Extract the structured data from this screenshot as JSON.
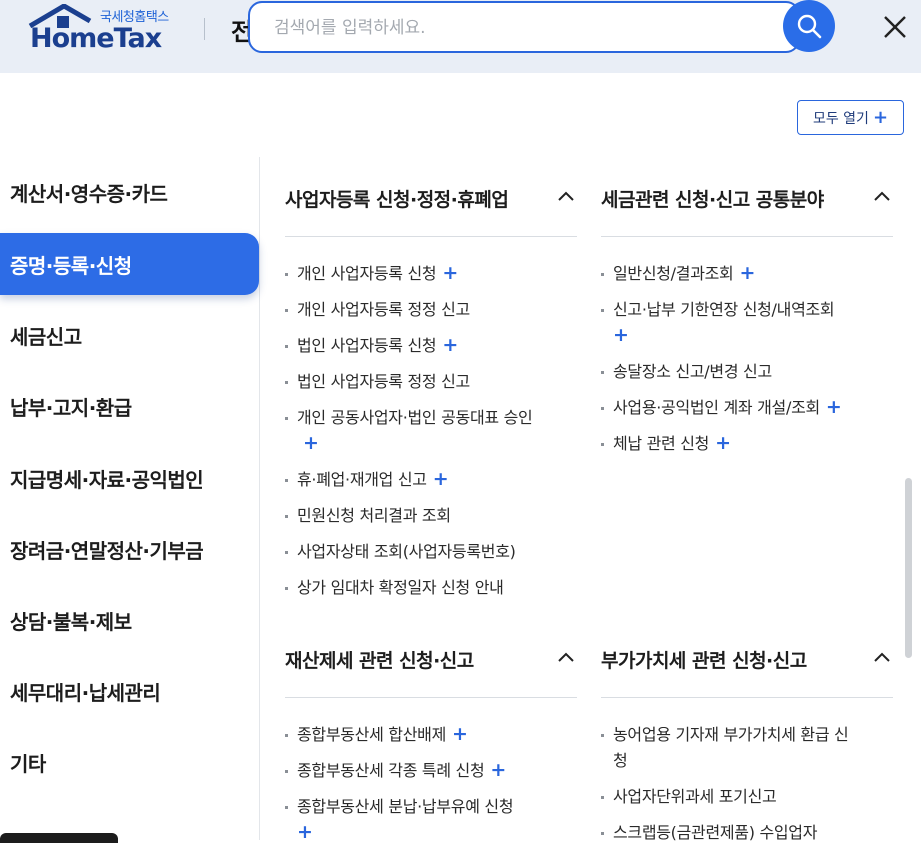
{
  "header": {
    "logo_small": "국세청홈택스",
    "logo_big": "HomeTax",
    "title_partial": "전",
    "search_placeholder": "검색어를 입력하세요.",
    "search_icon": "search-icon",
    "close_icon": "close-icon"
  },
  "open_all_label": "모두 열기",
  "sidebar": {
    "items": [
      {
        "label": "계산서·영수증·카드"
      },
      {
        "label": "증명·등록·신청",
        "active": true
      },
      {
        "label": "세금신고"
      },
      {
        "label": "납부·고지·환급"
      },
      {
        "label": "지급명세·자료·공익법인"
      },
      {
        "label": "장려금·연말정산·기부금"
      },
      {
        "label": "상담·불복·제보"
      },
      {
        "label": "세무대리·납세관리"
      },
      {
        "label": "기타"
      }
    ]
  },
  "sections": [
    {
      "title": "사업자등록 신청·정정·휴폐업",
      "items": [
        {
          "label": "개인 사업자등록 신청",
          "plus": true
        },
        {
          "label": "개인 사업자등록 정정 신고"
        },
        {
          "label": "법인 사업자등록 신청",
          "plus": true
        },
        {
          "label": "법인 사업자등록 정정 신고"
        },
        {
          "label": "개인 공동사업자·법인 공동대표 승인",
          "plus": true
        },
        {
          "label": "휴·폐업·재개업 신고",
          "plus": true
        },
        {
          "label": "민원신청 처리결과 조회"
        },
        {
          "label": "사업자상태 조회(사업자등록번호)"
        },
        {
          "label": "상가 임대차 확정일자 신청 안내"
        }
      ]
    },
    {
      "title": "세금관련 신청·신고 공통분야",
      "items": [
        {
          "label": "일반신청/결과조회",
          "plus": true
        },
        {
          "label": "신고·납부 기한연장 신청/내역조회",
          "plus": true
        },
        {
          "label": "송달장소 신고/변경 신고"
        },
        {
          "label": "사업용·공익법인 계좌 개설/조회",
          "plus": true
        },
        {
          "label": "체납 관련 신청",
          "plus": true
        }
      ]
    },
    {
      "title": "재산제세 관련 신청·신고",
      "items": [
        {
          "label": "종합부동산세 합산배제",
          "plus": true
        },
        {
          "label": "종합부동산세 각종 특례 신청",
          "plus": true
        },
        {
          "label": "종합부동산세 분납·납부유예 신청",
          "plus": true
        }
      ]
    },
    {
      "title": "부가가치세 관련 신청·신고",
      "items": [
        {
          "label": "농어업용 기자재 부가가치세 환급 신청"
        },
        {
          "label": "사업자단위과세 포기신고"
        },
        {
          "label": "스크랩등(금관련제품) 수입업자"
        }
      ]
    }
  ]
}
